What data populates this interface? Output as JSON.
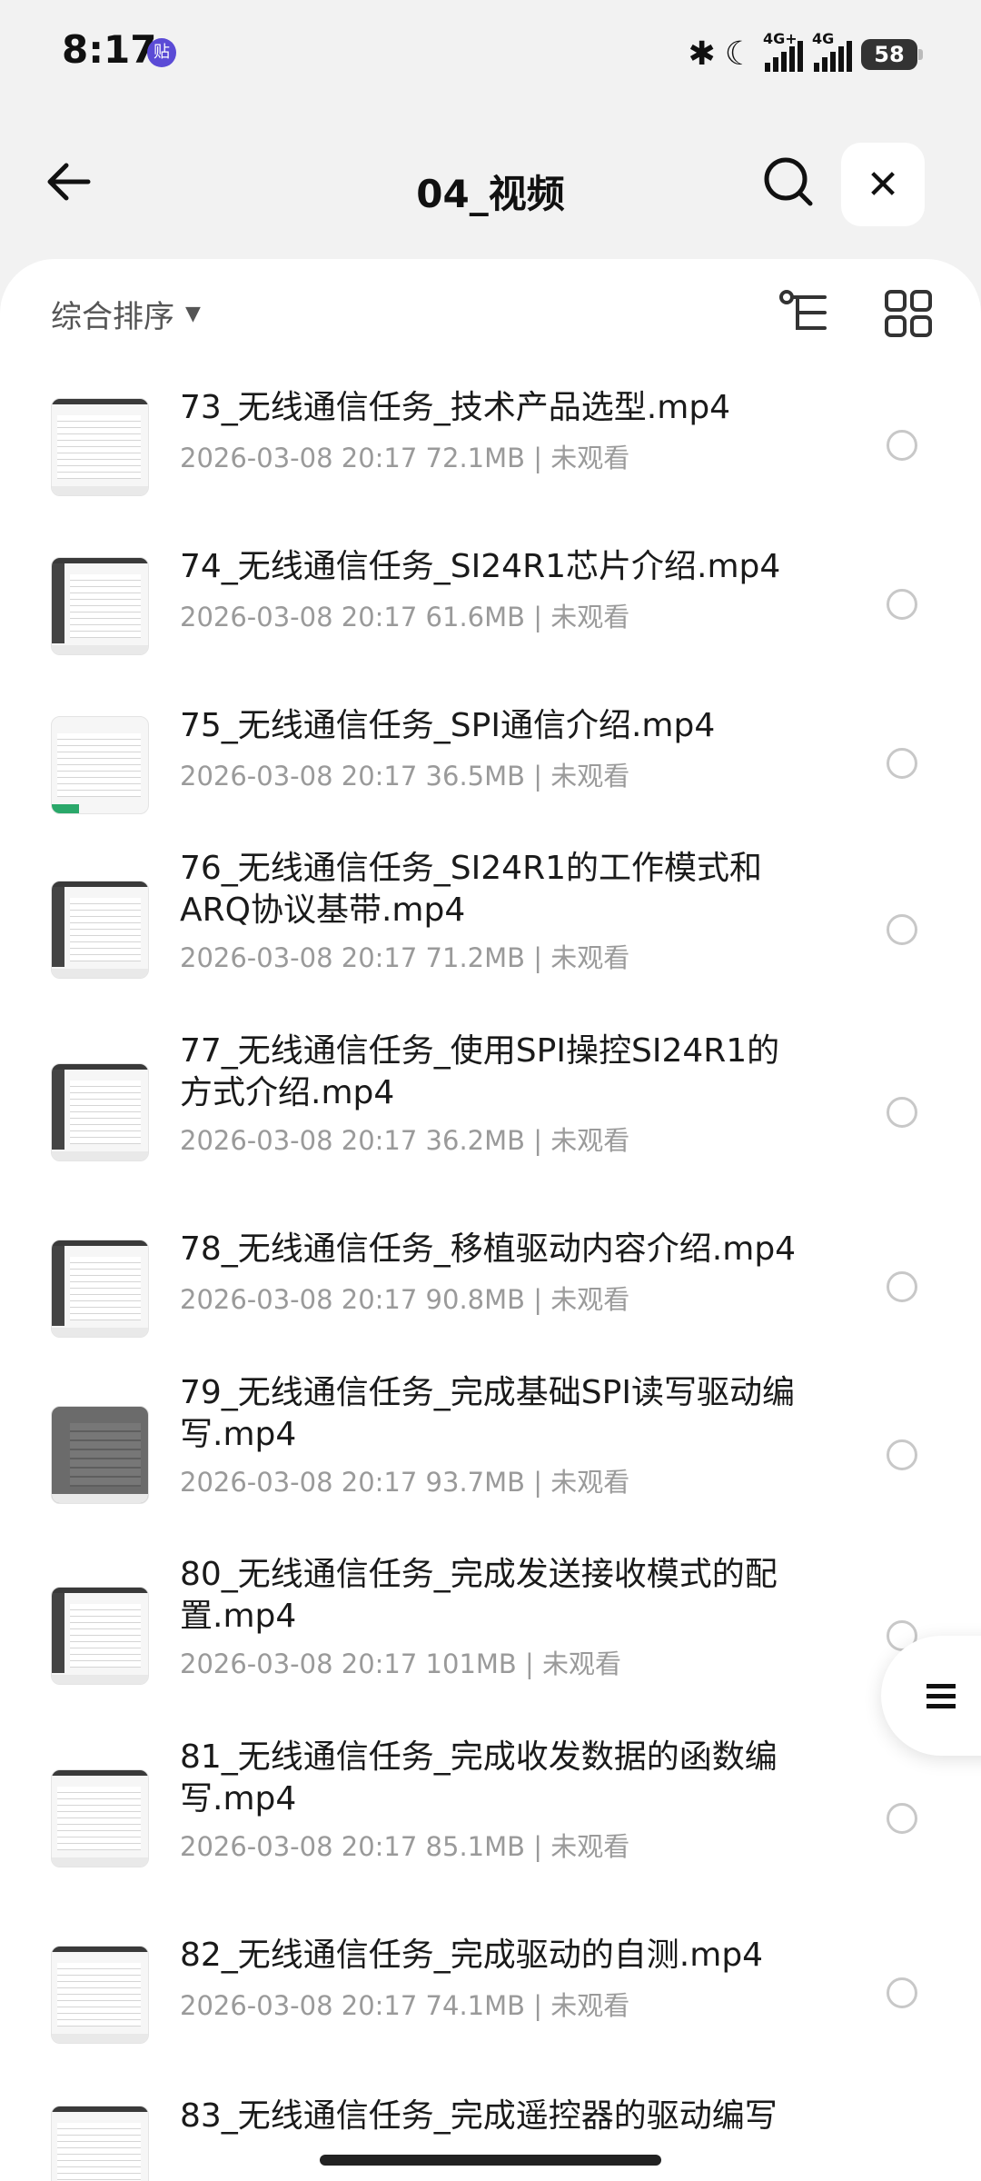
{
  "status": {
    "time": "8:17",
    "notif_badge": "贴",
    "network1": "4G+",
    "network2": "4G",
    "battery": "58"
  },
  "nav": {
    "title": "04_视频"
  },
  "toolbar": {
    "sort_label": "综合排序"
  },
  "files": [
    {
      "name": "73_无线通信任务_技术产品选型.mp4",
      "meta": "2026-03-08 20:17  72.1MB | 未观看"
    },
    {
      "name": "74_无线通信任务_SI24R1芯片介绍.mp4",
      "meta": "2026-03-08 20:17  61.6MB | 未观看"
    },
    {
      "name": "75_无线通信任务_SPI通信介绍.mp4",
      "meta": "2026-03-08 20:17  36.5MB | 未观看"
    },
    {
      "name": "76_无线通信任务_SI24R1的工作模式和ARQ协议基带.mp4",
      "meta": "2026-03-08 20:17  71.2MB | 未观看"
    },
    {
      "name": "77_无线通信任务_使用SPI操控SI24R1的方式介绍.mp4",
      "meta": "2026-03-08 20:17  36.2MB | 未观看"
    },
    {
      "name": "78_无线通信任务_移植驱动内容介绍.mp4",
      "meta": "2026-03-08 20:17  90.8MB | 未观看"
    },
    {
      "name": "79_无线通信任务_完成基础SPI读写驱动编写.mp4",
      "meta": "2026-03-08 20:17  93.7MB | 未观看"
    },
    {
      "name": "80_无线通信任务_完成发送接收模式的配置.mp4",
      "meta": "2026-03-08 20:17  101MB | 未观看"
    },
    {
      "name": "81_无线通信任务_完成收发数据的函数编写.mp4",
      "meta": "2026-03-08 20:17  85.1MB | 未观看"
    },
    {
      "name": "82_无线通信任务_完成驱动的自测.mp4",
      "meta": "2026-03-08 20:17  74.1MB | 未观看"
    },
    {
      "name": "83_无线通信任务_完成遥控器的驱动编写",
      "meta": ""
    }
  ]
}
